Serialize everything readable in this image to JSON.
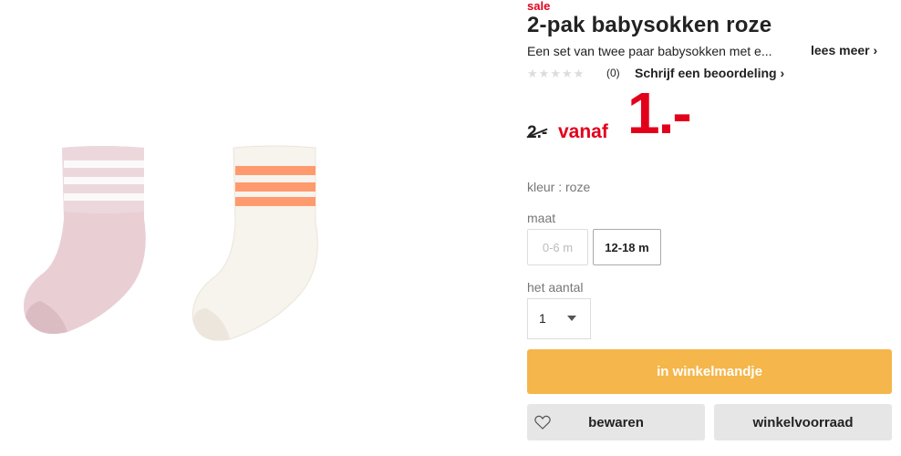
{
  "product": {
    "sale_tag": "sale",
    "title": "2-pak babysokken roze",
    "description": "Een set van twee paar babysokken met e...",
    "read_more": "lees meer ›",
    "rating": {
      "stars": 0,
      "max": 5,
      "count": "(0)"
    },
    "write_review": "Schrijf een beoordeling ›",
    "old_price": "2.-",
    "from_label": "vanaf",
    "price": "1.-",
    "color_label": "kleur : roze",
    "size_label": "maat",
    "sizes": [
      {
        "label": "0-6 m",
        "available": false
      },
      {
        "label": "12-18 m",
        "available": true
      }
    ],
    "quantity_label": "het aantal",
    "quantity_value": "1",
    "add_to_cart": "in winkelmandje",
    "save": "bewaren",
    "store_stock": "winkelvoorraad"
  },
  "colors": {
    "accent_red": "#e3001b",
    "cart_orange": "#f5b64b",
    "button_grey": "#e6e6e6"
  },
  "icons": [
    "star-icon",
    "heart-icon",
    "chevron-down-icon"
  ]
}
